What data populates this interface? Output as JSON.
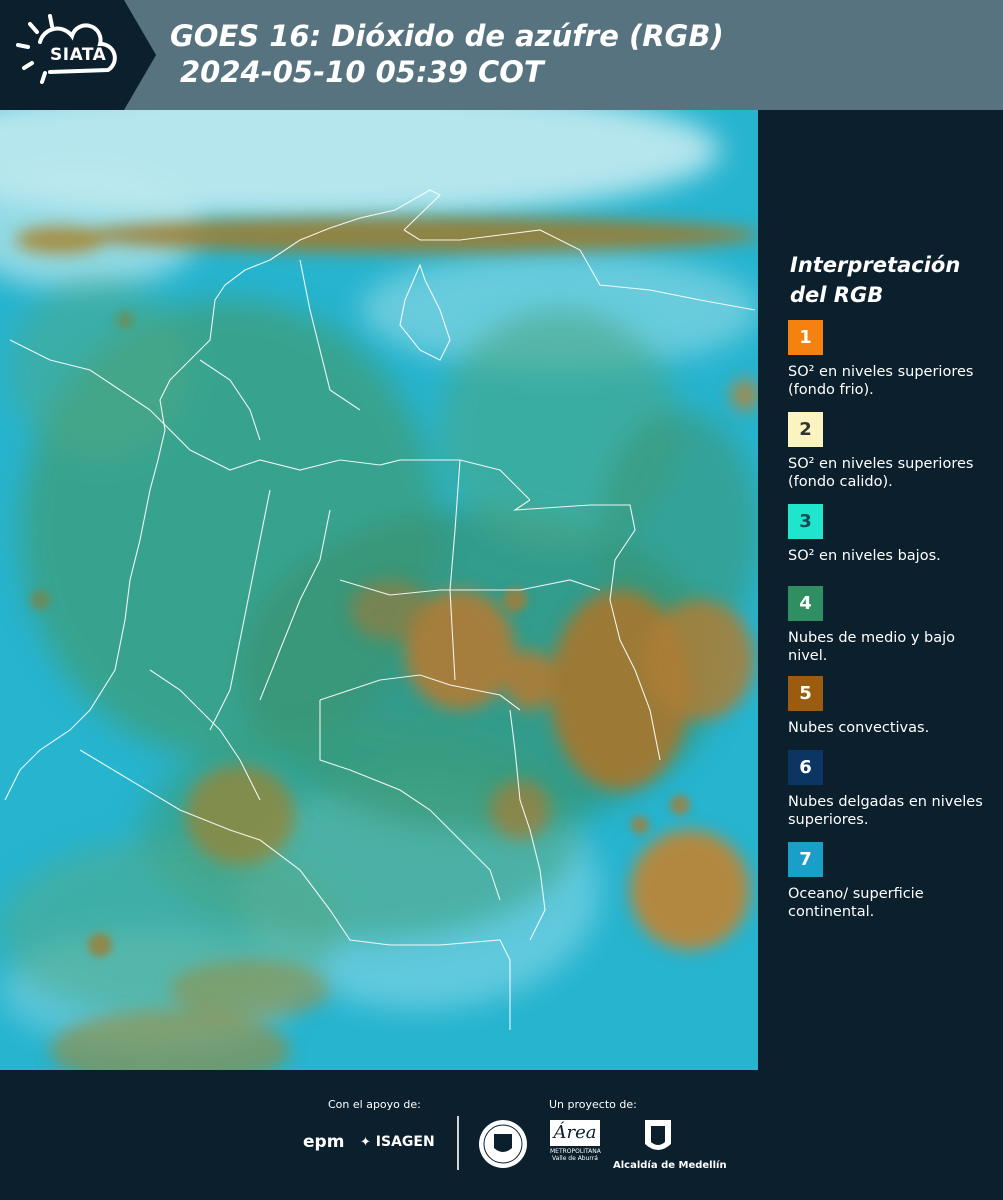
{
  "header": {
    "logo": "SIATA",
    "title_line1": "GOES 16: Dióxido de azúfre (RGB)",
    "title_line2": "2024-05-10 05:39 COT"
  },
  "legend": {
    "title_line1": "Interpretación",
    "title_line2": "del RGB",
    "items": [
      {
        "num": "1",
        "color": "#f5820f",
        "num_color": "#ffffff",
        "label": "SO² en niveles superiores (fondo frio)."
      },
      {
        "num": "2",
        "color": "#fbf3c0",
        "num_color": "#333333",
        "label": "SO² en niveles superiores (fondo calido)."
      },
      {
        "num": "3",
        "color": "#1fe5cc",
        "num_color": "#1a4a55",
        "label": "SO² en niveles bajos."
      },
      {
        "num": "4",
        "color": "#2f8f62",
        "num_color": "#ffffff",
        "label": "Nubes de medio y bajo nivel."
      },
      {
        "num": "5",
        "color": "#9c5c10",
        "num_color": "#ffffff",
        "label": "Nubes convectivas."
      },
      {
        "num": "6",
        "color": "#0b3563",
        "num_color": "#ffffff",
        "label": "Nubes delgadas en niveles superiores."
      },
      {
        "num": "7",
        "color": "#1aa0c8",
        "num_color": "#ffffff",
        "label": "Oceano/ superficie continental."
      }
    ]
  },
  "footer": {
    "support_label": "Con el apoyo de:",
    "project_label": "Un proyecto de:",
    "logo_epm": "epm",
    "logo_isagen": "ISAGEN",
    "logo_area_line1": "Área",
    "logo_area_line2": "METROPOLITANA",
    "logo_area_line3": "Valle de Aburrá",
    "logo_alcaldia": "Alcaldía de Medellín"
  },
  "colors": {
    "background": "#0b1f2c",
    "header": "#56737f",
    "ocean": "#1aa0c8",
    "cloud_convective": "#9c5c10",
    "cloud_mid_low": "#2f8f62"
  }
}
